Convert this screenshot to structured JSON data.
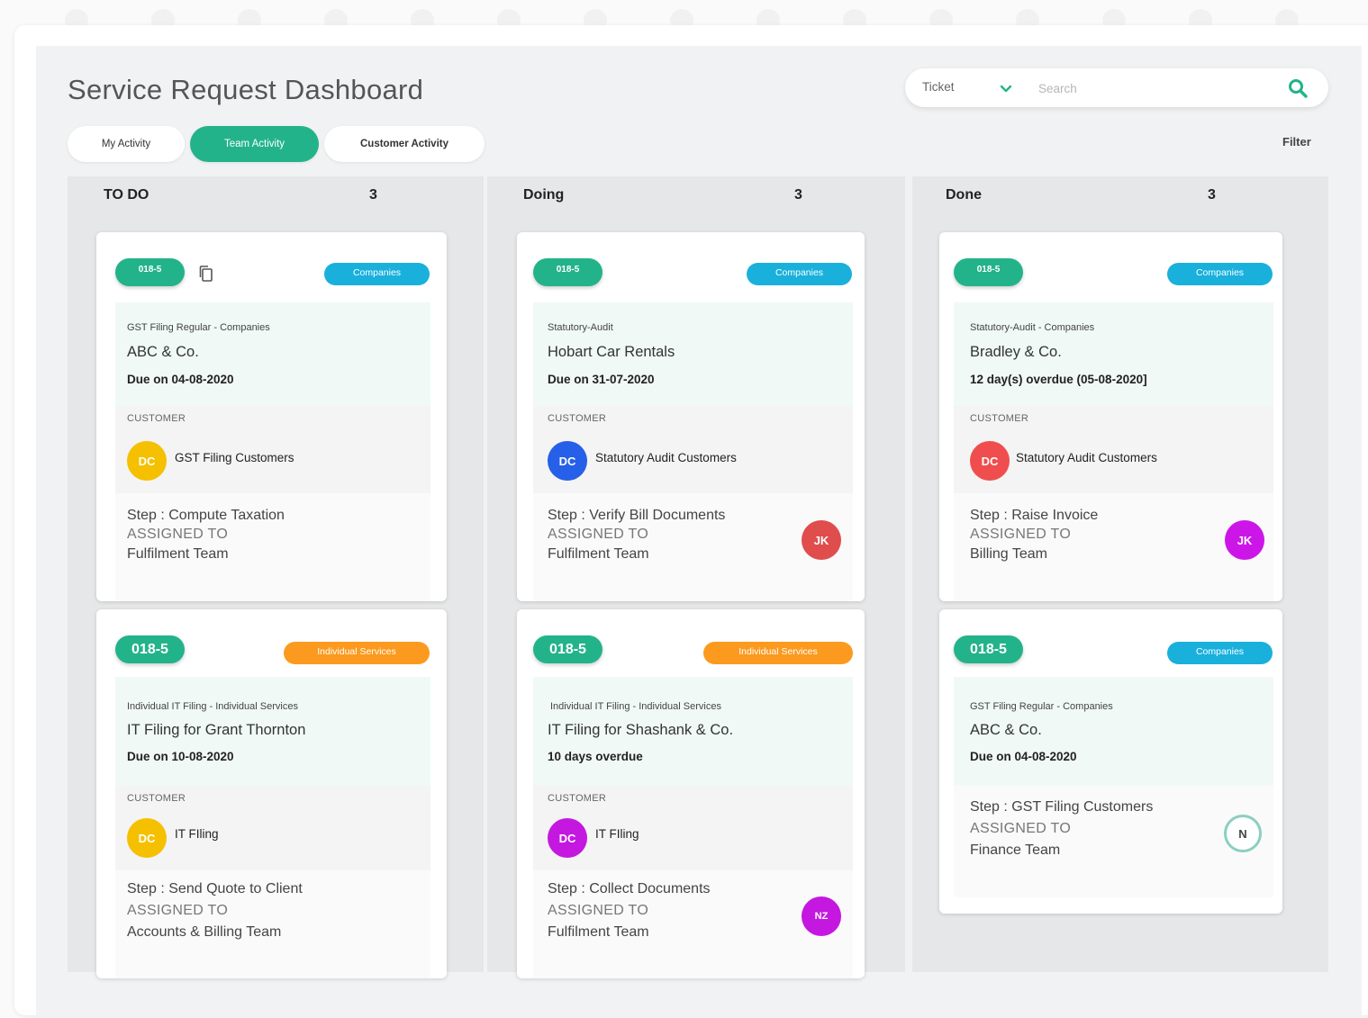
{
  "page": {
    "title": "Service Request Dashboard",
    "filter_label": "Filter"
  },
  "tabs": [
    {
      "label": "My Activity",
      "active": false
    },
    {
      "label": "Team Activity",
      "active": true
    },
    {
      "label": "Customer Activity",
      "active": false
    }
  ],
  "search": {
    "type_label": "Ticket",
    "placeholder": "Search"
  },
  "colors": {
    "accent": "#23b38a",
    "companies_tag": "#1ab0dc",
    "individual_tag": "#fb9a1e"
  },
  "labels": {
    "customer": "CUSTOMER",
    "assigned_to": "ASSIGNED TO"
  },
  "columns": [
    {
      "title": "TO DO",
      "count": "3",
      "cards": [
        {
          "id": "018-5",
          "tag": "Companies",
          "service": "GST Filing Regular - Companies",
          "client": "ABC & Co.",
          "due": "Due on 04-08-2020",
          "customer_initials": "DC",
          "customer_color": "#f5c000",
          "customer_name": "GST Filing Customers",
          "step": "Step : Compute Taxation",
          "team": "Fulfilment Team"
        },
        {
          "id": "018-5",
          "tag": "Individual Services",
          "service": "Individual IT Filing - Individual Services",
          "client": "IT Filing for Grant Thornton",
          "due": "Due on 10-08-2020",
          "customer_initials": "DC",
          "customer_color": "#f5c000",
          "customer_name": "IT FIling",
          "step": "Step : Send Quote to Client",
          "team": "Accounts & Billing Team"
        }
      ]
    },
    {
      "title": "Doing",
      "count": "3",
      "cards": [
        {
          "id": "018-5",
          "tag": "Companies",
          "service": "Statutory-Audit",
          "client": "Hobart Car Rentals",
          "due": "Due on 31-07-2020",
          "customer_initials": "DC",
          "customer_color": "#2660e8",
          "customer_name": "Statutory Audit Customers",
          "step": "Step : Verify Bill Documents",
          "team": "Fulfilment Team",
          "assignee_initials": "JK",
          "assignee_color": "#e04d4d"
        },
        {
          "id": "018-5",
          "tag": "Individual Services",
          "service": "Individual IT Filing - Individual Services",
          "client": "IT Filing for Shashank & Co.",
          "due": "10 days overdue",
          "customer_initials": "DC",
          "customer_color": "#c418e0",
          "customer_name": "IT FIling",
          "step": "Step : Collect Documents",
          "team": "Fulfilment Team",
          "assignee_initials": "NZ",
          "assignee_color": "#c418e0"
        }
      ]
    },
    {
      "title": "Done",
      "count": "3",
      "cards": [
        {
          "id": "018-5",
          "tag": "Companies",
          "service": "Statutory-Audit - Companies",
          "client": "Bradley & Co.",
          "due": "12 day(s) overdue (05-08-2020]",
          "customer_initials": "DC",
          "customer_color": "#f04e4e",
          "customer_name": "Statutory Audit Customers",
          "step": "Step : Raise Invoice",
          "team": "Billing Team",
          "assignee_initials": "JK",
          "assignee_color": "#cc16e8"
        },
        {
          "id": "018-5",
          "tag": "Companies",
          "service": "GST Filing Regular - Companies",
          "client": "ABC & Co.",
          "due": "Due on 04-08-2020",
          "step": "Step : GST Filing Customers",
          "team": "Finance Team",
          "assignee_initials": "N"
        }
      ]
    }
  ],
  "icons": {
    "chevron": "chevron-down-icon",
    "search": "search-icon",
    "copy": "copy-icon"
  }
}
